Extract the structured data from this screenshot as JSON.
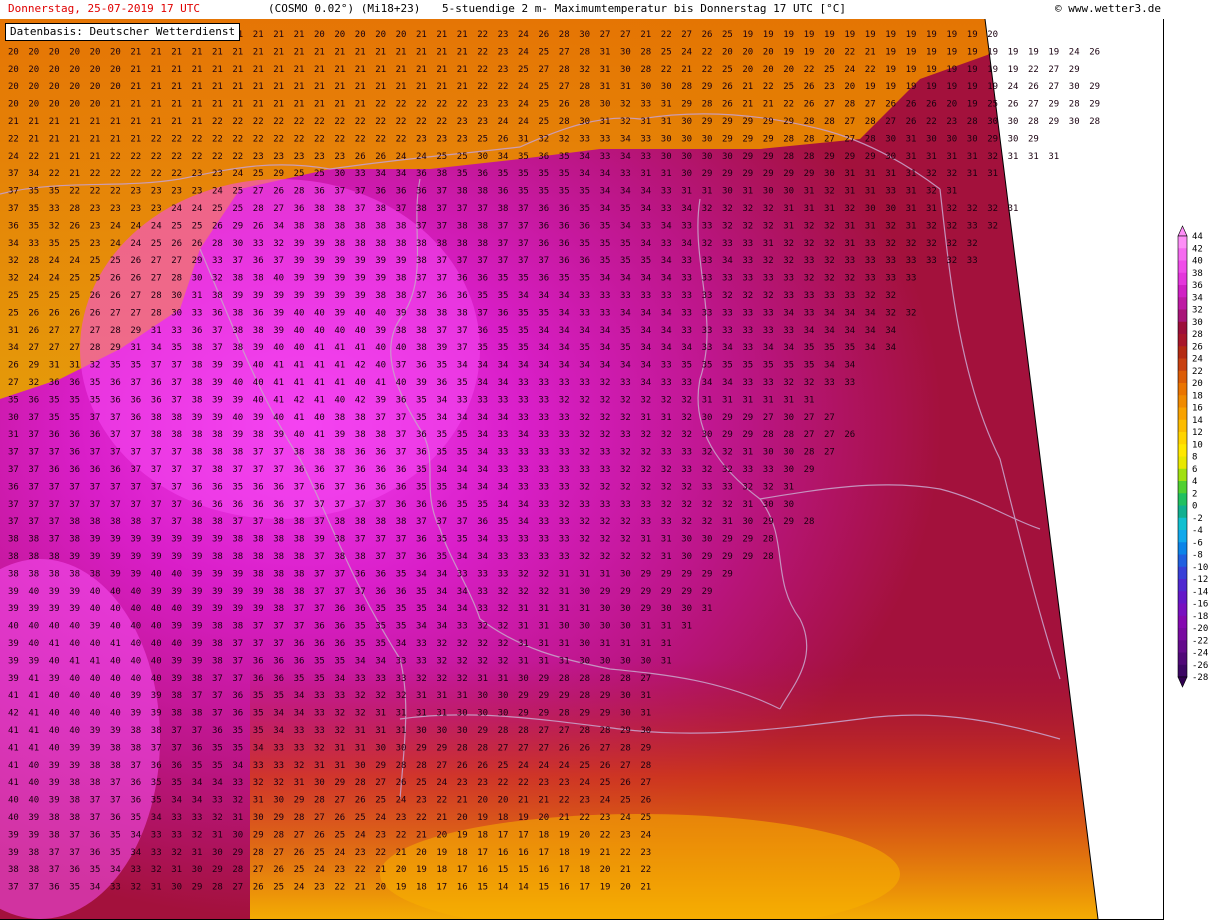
{
  "header": {
    "date_time": "Donnerstag, 25-07-2019  17 UTC",
    "model_run": "(COSMO 0.02°) (Mi18+23)",
    "description": "5-stuendige 2 m- Maximumtemperatur bis Donnerstag 17 UTC [°C]",
    "copyright_symbol": "©",
    "site": "www.wetter3.de"
  },
  "map": {
    "source_note": "Datenbasis: Deutscher Wetterdienst",
    "region": "Germany and neighbouring countries",
    "value_grid_rows": [
      "20 20 20 20 20 20 21 21 21 21 21 21 21 21 21 20 20 20 20 20 21 21 21 22 23 24 26 28 30 27 27 21 22 27 26 25 19 19 19 19 19 19 19 19 19 19 19 19 20",
      "20 20 20 20 20 20 21 21 21 21 21 21 21 21 21 21 21 21 21 21 21 21 21 22 23 24 25 27 28 31 30 28 25 24 22 20 20 20 19 19 20 22 21 19 19 19 19 19 19 19 19 19 24 26",
      "20 20 20 20 20 20 21 21 21 21 21 21 21 21 21 21 21 21 21 21 21 21 21 22 23 25 27 28 32 31 30 28 22 21 22 25 20 20 20 22 25 24 22 19 19 19 19 19 19 19 22 27 29",
      "20 20 20 20 20 20 21 21 21 21 21 21 21 21 21 21 21 21 21 21 21 21 21 22 22 24 25 27 28 31 31 30 30 28 29 26 21 22 25 26 23 20 19 19 19 19 19 19 19 24 26 27 30 29",
      "20 20 20 20 20 21 21 21 21 21 21 21 21 21 21 21 21 21 22 22 22 22 22 23 23 24 25 26 28 30 32 33 31 29 28 26 21 21 22 26 27 28 27 26 26 26 20 19 25 26 27 29 28 29",
      "21 21 21 21 21 21 21 21 21 21 22 22 22 22 22 22 22 22 22 22 22 22 23 23 24 24 25 28 30 31 32 31 31 30 29 29 29 29 29 28 28 27 28 27 26 22 23 28 30 30 28 29 30 28",
      "22 21 21 21 21 21 21 22 22 22 22 22 22 22 22 22 22 22 22 22 23 23 23 25 26 31 32 32 33 33 34 33 30 30 30 29 29 29 28 28 27 27 28 30 31 30 30 30 29 30 29",
      "24 22 21 21 21 22 22 22 22 22 22 22 23 23 23 23 23 26 26 24 24 25 25 30 34 35 36 35 34 33 34 33 30 30 30 30 29 29 28 28 29 29 29 30 31 31 31 31 32 31 31 31",
      "37 34 22 21 22 22 22 22 22 23 23 24 25 29 25 25 30 33 34 34 36 38 35 36 35 35 35 35 34 34 33 31 31 30 29 29 29 29 29 29 30 31 31 31 31 32 32 31 31",
      "37 35 35 22 22 22 23 23 23 23 24 25 27 26 28 36 37 37 36 36 36 37 38 38 36 35 35 35 35 34 34 34 33 31 31 30 31 30 30 31 32 31 31 33 31 32 31",
      "37 35 33 28 23 23 23 23 24 24 25 25 28 27 36 38 38 37 38 37 38 37 37 37 38 37 36 36 35 34 35 34 33 34 32 32 32 32 31 31 31 32 30 30 31 31 32 32 32 31",
      "36 35 32 26 23 24 24 24 25 25 26 29 26 34 38 38 38 38 38 38 37 37 38 38 37 37 36 36 36 35 34 33 34 33 33 32 32 32 31 32 32 31 31 32 31 32 32 33 32",
      "34 33 35 25 23 24 24 25 26 26 28 30 33 32 39 39 38 38 38 38 38 38 38 38 37 37 36 36 35 35 35 34 33 34 32 33 33 31 32 32 32 31 33 32 32 32 32 32",
      "32 28 24 24 25 25 26 27 27 29 33 37 36 37 39 39 39 39 39 39 38 37 37 37 37 37 37 36 36 35 35 35 34 33 33 34 33 32 32 33 32 33 33 33 33 33 32 33",
      "32 24 24 25 25 26 26 27 28 30 32 38 38 40 39 39 39 39 39 38 37 37 36 36 35 35 36 35 35 34 34 34 34 33 33 33 33 33 33 32 32 32 33 33 33",
      "25 25 25 25 26 26 27 28 30 31 38 39 39 39 39 39 39 39 38 38 37 36 36 35 35 34 34 34 33 33 33 33 33 33 33 32 32 32 33 33 33 33 32 32",
      "25 26 26 26 26 27 27 28 30 33 36 38 36 39 40 40 39 40 40 39 38 38 38 37 36 35 35 34 33 33 34 34 34 33 33 33 33 33 34 33 34 34 34 32 32",
      "31 26 27 27 27 28 29 31 33 36 37 38 38 39 40 40 40 40 39 38 38 37 37 36 35 35 34 34 34 34 35 34 34 33 33 33 33 33 33 34 34 34 34 34",
      "34 27 27 27 28 29 31 34 35 38 37 38 39 40 40 41 41 41 40 40 38 39 37 35 35 35 34 34 35 34 35 34 34 34 33 34 33 34 34 35 35 35 34 34",
      "26 29 31 31 32 35 35 37 37 38 39 39 40 41 41 41 41 42 40 37 36 35 34 34 34 34 34 34 34 34 34 34 33 35 35 35 35 35 35 35 34 34",
      "27 32 36 36 35 36 37 36 37 38 39 40 40 41 41 41 41 40 41 40 39 36 35 34 34 33 33 33 33 32 33 34 33 33 34 34 33 33 32 32 33 33",
      "35 36 35 35 35 36 36 36 37 38 39 39 40 41 42 41 40 42 39 36 35 34 33 33 33 33 33 32 32 32 32 32 32 32 31 31 31 31 31 31",
      "30 37 35 35 37 37 36 38 38 39 39 40 39 40 41 40 38 38 37 37 35 34 34 34 34 33 33 33 32 32 32 31 31 32 30 29 29 27 30 27 27",
      "31 37 36 36 36 37 37 38 38 38 38 39 38 39 40 41 39 38 38 37 36 35 35 34 33 34 33 33 32 32 33 32 32 32 30 29 29 28 28 27 27 26",
      "37 37 37 36 37 37 37 37 37 38 38 38 37 37 38 38 38 36 36 37 36 35 35 34 33 33 33 33 32 33 32 32 33 33 32 32 31 30 30 28 27",
      "37 37 36 36 36 36 37 37 37 37 38 37 37 37 36 36 37 36 36 36 35 34 34 34 33 33 33 33 33 33 32 32 32 33 32 32 33 33 30 29",
      "36 37 37 37 37 37 37 37 37 36 36 35 36 36 37 36 37 36 36 36 35 35 34 34 34 33 33 33 32 32 32 32 32 32 33 33 32 32 31",
      "37 37 37 37 37 37 37 37 37 36 36 36 36 36 37 37 37 37 37 36 36 36 35 35 34 34 33 32 33 33 33 33 32 32 32 32 31 30 30",
      "37 37 37 38 38 38 38 37 37 38 38 37 37 38 38 37 38 38 38 38 37 37 37 36 35 34 33 33 32 32 32 33 33 32 32 31 30 29 29 28",
      "38 38 37 38 39 39 39 39 39 39 39 38 38 38 38 39 38 37 37 37 36 35 35 34 33 33 33 33 32 32 32 31 31 30 30 29 29 28",
      "38 38 38 39 39 39 39 39 39 39 38 38 38 38 38 37 38 38 37 37 36 35 34 34 33 33 33 33 32 32 32 32 31 30 29 29 29 28",
      "38 38 38 38 38 39 39 40 40 39 39 39 38 38 38 37 37 36 36 35 34 34 33 33 33 32 32 31 31 31 30 29 29 29 29 29",
      "39 40 39 39 40 40 40 39 39 39 39 39 39 38 38 37 37 37 36 36 35 34 34 33 32 32 32 31 30 29 29 29 29 29 29",
      "39 39 39 39 40 40 40 40 40 39 39 39 39 38 37 37 36 36 35 35 35 34 34 33 32 31 31 31 31 30 30 29 30 30 31",
      "40 40 40 40 39 40 40 40 39 39 38 38 37 37 37 36 36 35 35 35 34 34 33 32 32 31 31 30 30 30 30 31 31 31",
      "39 40 41 40 40 41 40 40 40 39 38 37 37 37 36 36 36 35 35 34 33 32 32 32 32 31 31 31 30 31 31 31 31",
      "39 39 40 41 41 40 40 40 39 39 38 37 36 36 36 35 35 34 34 33 33 32 32 32 32 31 31 31 30 30 30 30 31",
      "39 41 39 40 40 40 40 40 39 38 37 37 36 36 35 35 34 33 33 33 32 32 32 31 31 30 29 28 28 28 28 27",
      "41 41 40 40 40 40 39 39 38 37 37 36 35 35 34 33 33 32 32 32 31 31 31 30 30 29 29 29 28 29 30 31",
      "42 41 40 40 40 40 39 39 38 38 37 36 35 34 34 33 32 32 31 31 31 31 30 30 30 29 29 28 29 29 30 31",
      "41 41 40 40 39 39 38 38 37 37 36 35 35 34 33 33 32 31 31 31 30 30 30 29 28 28 27 27 28 28 29 30",
      "41 41 40 39 39 38 38 37 37 36 35 35 34 33 33 32 31 31 30 30 29 29 28 28 27 27 27 26 26 27 28 29",
      "41 40 39 39 38 38 37 36 36 35 35 34 33 33 32 31 31 30 29 28 28 27 26 26 25 24 24 24 25 26 27 28",
      "41 40 39 38 38 37 36 35 35 34 34 33 32 32 31 30 29 28 27 26 25 24 23 23 22 22 23 23 24 25 26 27",
      "40 40 39 38 37 37 36 35 34 34 33 32 31 30 29 28 27 26 25 24 23 22 21 20 20 21 21 22 23 24 25 26",
      "40 39 38 38 37 36 35 34 33 33 32 31 30 29 28 27 26 25 24 23 22 21 20 19 18 19 20 21 22 23 24 25",
      "39 39 38 37 36 35 34 33 33 32 31 30 29 28 27 26 25 24 23 22 21 20 19 18 17 17 18 19 20 22 23 24",
      "39 38 37 37 36 35 34 33 32 31 30 29 28 27 26 25 24 23 22 21 20 19 18 17 16 16 17 18 19 21 22 23",
      "38 38 37 36 35 34 33 32 31 30 29 28 27 26 25 24 23 22 21 20 19 18 17 16 15 15 16 17 18 20 21 22",
      "37 37 36 35 34 33 32 31 30 29 28 27 26 25 24 23 22 21 20 19 18 17 16 15 14 14 15 16 17 19 20 21"
    ]
  },
  "legend": {
    "labels": [
      "44",
      "42",
      "40",
      "38",
      "36",
      "34",
      "32",
      "30",
      "28",
      "26",
      "24",
      "22",
      "20",
      "18",
      "16",
      "14",
      "12",
      "10",
      "8",
      "6",
      "4",
      "2",
      "0",
      "-2",
      "-4",
      "-6",
      "-8",
      "-10",
      "-12",
      "-14",
      "-16",
      "-18",
      "-20",
      "-22",
      "-24",
      "-26",
      "-28"
    ],
    "colors": [
      "#fe8ef7",
      "#f66af0",
      "#f04ce9",
      "#e436dc",
      "#d020c4",
      "#be1aa4",
      "#a81478",
      "#9c0e3a",
      "#a8162a",
      "#b42a12",
      "#c84010",
      "#dc5c06",
      "#ea7400",
      "#f08a00",
      "#f8a200",
      "#fcbc00",
      "#ffd400",
      "#ffe800",
      "#e8e800",
      "#a0e010",
      "#50d030",
      "#20c060",
      "#10b090",
      "#10c0d0",
      "#10a8ec",
      "#0c84e8",
      "#2060e0",
      "#3840d8",
      "#5028d0",
      "#6418c8",
      "#7810c0",
      "#8408b0",
      "#780aa0",
      "#640a8c",
      "#500878",
      "#3c0664"
    ],
    "arrow_color": "#300050"
  }
}
